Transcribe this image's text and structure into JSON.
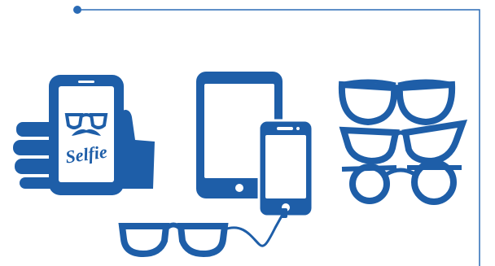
{
  "selfie_phone": {
    "screen_text": "Selfie"
  },
  "colors": {
    "primary_blue": "#1e5ea8",
    "frame_line": "#2a6bb5",
    "background": "#ffffff"
  },
  "icons": [
    "frame-corner-line",
    "hand-holding-phone-selfie-icon",
    "tablet-icon",
    "smartphone-icon",
    "connected-glasses-icon",
    "stacked-glasses-styles-icon"
  ]
}
